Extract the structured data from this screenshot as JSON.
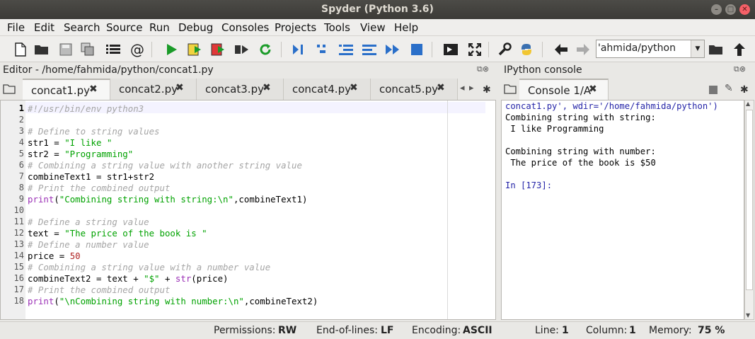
{
  "window": {
    "title": "Spyder (Python 3.6)"
  },
  "menu": [
    "File",
    "Edit",
    "Search",
    "Source",
    "Run",
    "Debug",
    "Consoles",
    "Projects",
    "Tools",
    "View",
    "Help"
  ],
  "toolbar": {
    "path": "'ahmida/python"
  },
  "editor": {
    "pane_title": "Editor - /home/fahmida/python/concat1.py",
    "tabs": [
      "concat1.py",
      "concat2.py",
      "concat3.py",
      "concat4.py",
      "concat5.py"
    ],
    "active_tab": "concat1.py",
    "line_numbers": [
      "1",
      "2",
      "3",
      "4",
      "5",
      "6",
      "7",
      "8",
      "9",
      "10",
      "11",
      "12",
      "13",
      "14",
      "15",
      "16",
      "17",
      "18"
    ],
    "code": [
      "#!/usr/bin/env python3",
      "",
      "# Define to string values",
      "str1 = \"I like \"",
      "str2 = \"Programming\"",
      "# Combining a string value with another string value",
      "combineText1 = str1+str2",
      "# Print the combined output",
      "print(\"Combining string with string:\\n\",combineText1)",
      "",
      "# Define a string value",
      "text = \"The price of the book is \"",
      "# Define a number value",
      "price = 50",
      "# Combining a string value with a number value",
      "combineText2 = text + \"$\" + str(price)",
      "# Print the combined output",
      "print(\"\\nCombining string with number:\\n\",combineText2)"
    ]
  },
  "console": {
    "pane_title": "IPython console",
    "tab": "Console 1/A",
    "lines": [
      "concat1.py', wdir='/home/fahmida/python')",
      "Combining string with string:",
      " I like Programming",
      "",
      "Combining string with number:",
      " The price of the book is $50",
      "",
      "In [173]:"
    ]
  },
  "status": {
    "permissions_label": "Permissions:",
    "permissions_value": "RW",
    "eol_label": "End-of-lines:",
    "eol_value": "LF",
    "encoding_label": "Encoding:",
    "encoding_value": "ASCII",
    "line_label": "Line:",
    "line_value": "1",
    "column_label": "Column:",
    "column_value": "1",
    "memory_label": "Memory:",
    "memory_value": "75 %"
  },
  "colors": {
    "comment": "#a5a5a5",
    "string": "#00a200",
    "builtin": "#9b30b6",
    "number": "#b02222",
    "accent": "#2a6fc9"
  },
  "icons": [
    "new-file-icon",
    "open-folder-icon",
    "save-icon",
    "save-all-icon",
    "list-icon",
    "at-icon",
    "run-icon",
    "run-cell-icon",
    "run-cell-advance-icon",
    "run-selection-icon",
    "rerun-icon",
    "debug-icon",
    "step-icon",
    "step-into-icon",
    "step-return-icon",
    "continue-icon",
    "stop-icon",
    "maximize-icon",
    "fullscreen-icon",
    "wrench-icon",
    "python-icon",
    "back-arrow-icon",
    "forward-arrow-icon",
    "browse-folder-icon",
    "up-arrow-icon"
  ]
}
